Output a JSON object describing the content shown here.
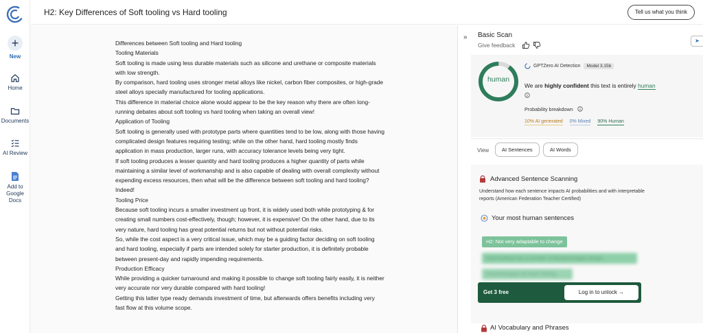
{
  "header": {
    "title": "H2: Key Differences of Soft tooling vs Hard tooling",
    "feedback_button": "Tell us what you think"
  },
  "sidebar": {
    "items": [
      {
        "label": "New",
        "icon": "plus-icon"
      },
      {
        "label": "Home",
        "icon": "home-icon"
      },
      {
        "label": "Documents",
        "icon": "folder-icon"
      },
      {
        "label": "AI Review",
        "icon": "checklist-icon"
      },
      {
        "label": "Add to Google Docs",
        "icon": "google-docs-icon"
      }
    ]
  },
  "document": {
    "lines": [
      "Differences between Soft tooling and Hard tooling",
      "Tooling Materials",
      "Soft tooling is made using less durable materials such as silicone and urethane or composite materials with low strength.",
      "By comparison, hard tooling uses stronger metal alloys like nickel, carbon fiber composites, or high-grade steel alloys specially manufactured for tooling applications.",
      "This difference in material choice alone would appear to be the key reason why there are often long-running debates about soft tooling vs hard tooling when taking an overall view!",
      "Application of Tooling",
      "Soft tooling is generally used with prototype parts where quantities tend to be low, along with those having complicated design features requiring testing; while on the other hand, hard tooling mostly finds application in mass production, larger runs, with accuracy tolerance levels being very tight.",
      "If soft tooling produces a lesser quantity and hard tooling produces a higher quantity of parts while maintaining a similar level of workmanship and is also capable of dealing with overall complexity without expending excess resources, then what will be the difference between soft tooling and hard tooling? Indeed!",
      "Tooling Price",
      "Because soft tooling incurs a smaller investment up front, it is widely used both while prototyping & for creating small numbers cost-effectively, though; however, it is expensive! On the other hand, due to its very nature, hard tooling has great potential returns but not without potential risks.",
      "So, while the cost aspect is a very critical issue, which may be a guiding factor deciding on soft tooling and hard tooling, especially if parts are intended solely for starter production, it is definitely probable between present-day and rapidly impending requirements.",
      "Production Efficacy",
      "While providing a quicker turnaround and making it possible to change soft tooling fairly easily, it is neither very accurate nor very durable compared with hard tooling!",
      "Getting this latter type ready demands investment of time, but afterwards offers benefits including very fast flow at this volume scope."
    ]
  },
  "panel": {
    "collapse_icon": "double-chevron-right-icon",
    "scan_title": "Basic Scan",
    "give_feedback": "Give feedback",
    "detection_label": "GPTZero AI Detection",
    "model_badge": "Model 3.15b",
    "ring_label": "human",
    "human_fraction": 0.9,
    "confidence_prefix": "We are ",
    "confidence_bold": "highly confident",
    "confidence_middle": " this text is entirely ",
    "confidence_result": "human",
    "probability_title": "Probability breakdown",
    "prob_ai": "10% AI generated",
    "prob_mixed": "0% Mixed",
    "prob_human": "90% Human",
    "view_label": "View",
    "view_sentences": "AI Sentences",
    "view_words": "AI Words",
    "adv_title": "Advanced Sentence Scanning",
    "adv_desc": "Understand how each sentence impacts AI probabilities and with interpretable reports (American Federation Teacher Certified)",
    "most_human_title": "Your most human sentences",
    "sentence_1": "H2: Not very adaptable to change",
    "sentence_2": "Hard tooling has a number of disadvantages despit...",
    "sentence_3": "Disadvantages of Hard Tooling",
    "get_free": "Get 3 free",
    "login_unlock": "Log in to unlock →",
    "vocab_title": "AI Vocabulary and Phrases"
  },
  "colors": {
    "accent_green": "#2e7d5b",
    "dark_green": "#1e5a3d",
    "ai_amber": "#b7791f",
    "mixed_blue": "#5b7fb3"
  }
}
